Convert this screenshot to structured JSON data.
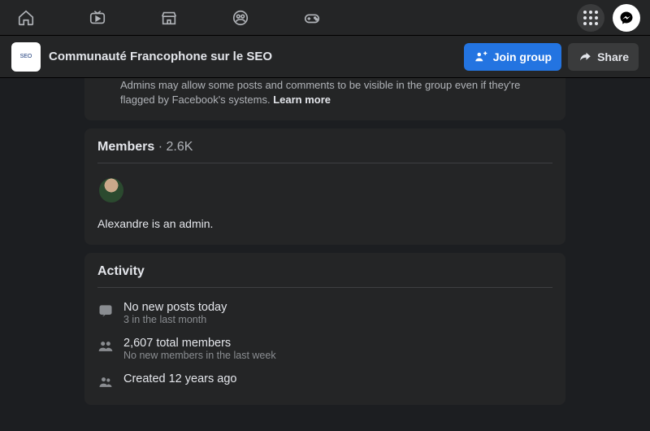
{
  "topnav": {
    "icons": [
      "home",
      "watch",
      "marketplace",
      "groups",
      "gaming"
    ],
    "menu_label": "menu",
    "messenger_label": "messenger"
  },
  "group": {
    "title": "Communauté Francophone sur le SEO",
    "thumb_text": "SEO",
    "join_label": "Join group",
    "share_label": "Share"
  },
  "admin_note": {
    "text": "Admins may allow some posts and comments to be visible in the group even if they're flagged by Facebook's systems. ",
    "learn_more": "Learn more"
  },
  "members": {
    "heading": "Members",
    "count_label": "2.6K",
    "admin_line": "Alexandre is an admin."
  },
  "activity": {
    "heading": "Activity",
    "posts_main": "No new posts today",
    "posts_sub": "3 in the last month",
    "members_main": "2,607 total members",
    "members_sub": "No new members in the last week",
    "created_main": "Created 12 years ago"
  }
}
